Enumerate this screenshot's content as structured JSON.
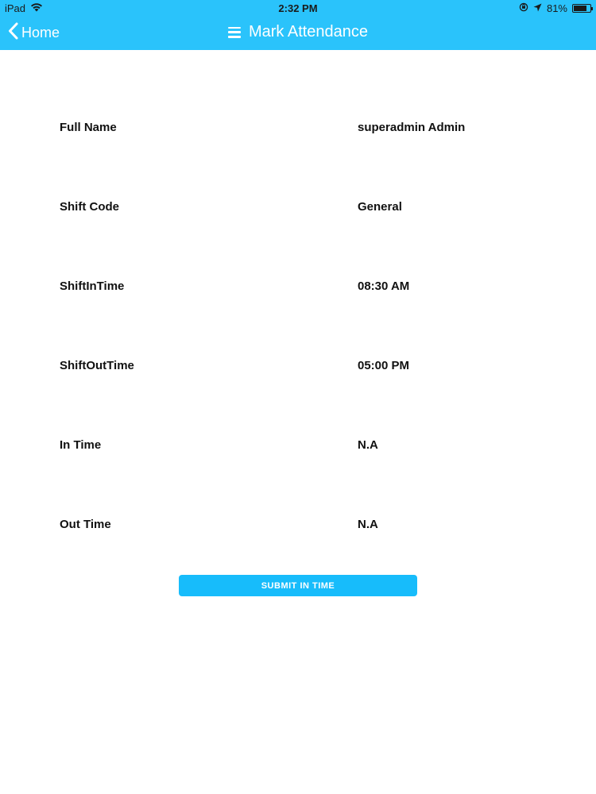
{
  "status_bar": {
    "device": "iPad",
    "time": "2:32 PM",
    "battery": "81%",
    "battery_level": 0.81,
    "icons": [
      "wifi-icon",
      "orientation-lock-icon",
      "location-arrow-icon",
      "battery-icon"
    ]
  },
  "nav": {
    "back_label": "Home",
    "title": "Mark Attendance",
    "icons": [
      "chevron-left-icon",
      "menu-icon"
    ]
  },
  "details": [
    {
      "label": "Full Name",
      "value": "superadmin Admin"
    },
    {
      "label": "Shift Code",
      "value": "General"
    },
    {
      "label": "ShiftInTime",
      "value": "08:30 AM"
    },
    {
      "label": "ShiftOutTime",
      "value": "05:00 PM"
    },
    {
      "label": "In Time",
      "value": "N.A"
    },
    {
      "label": "Out Time",
      "value": "N.A"
    }
  ],
  "submit": {
    "label": "SUBMIT IN TIME"
  },
  "colors": {
    "header": "#2ac3fb",
    "button": "#17bcfb"
  }
}
